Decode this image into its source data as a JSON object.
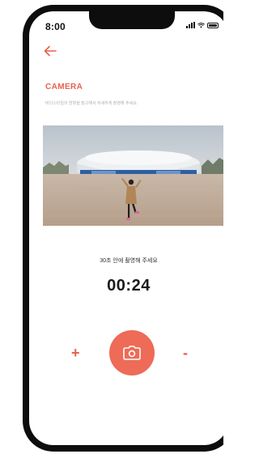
{
  "status_bar": {
    "time": "8:00"
  },
  "header": {
    "back_icon": "arrow-left-icon",
    "title": "CAMERA",
    "subtitle": "바디스타일의 방향을 참고해서 자세하게 촬영해 주세요."
  },
  "camera": {
    "instruction": "30초 안에 촬영해 주세요",
    "timer": "00:24",
    "plus_label": "+",
    "minus_label": "-",
    "capture_icon": "camera-icon"
  },
  "colors": {
    "accent": "#e8614c",
    "capture_button": "#ed6b57"
  }
}
